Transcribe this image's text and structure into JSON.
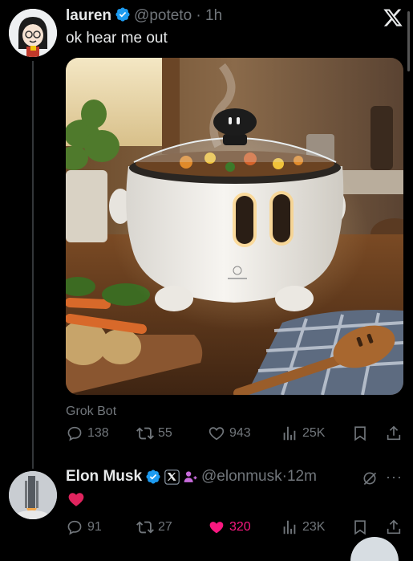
{
  "post1": {
    "display_name": "lauren",
    "handle": "@poteto",
    "time_sep": " · ",
    "time": "1h",
    "text": "ok hear me out",
    "media_source": "Grok Bot",
    "stats": {
      "replies": "138",
      "reposts": "55",
      "likes": "943",
      "views": "25K"
    }
  },
  "post2": {
    "display_name": "Elon Musk",
    "handle": "@elonmusk",
    "time_sep": "·",
    "time": "12m",
    "text_emoji": "heart-emoji",
    "more_label": "···",
    "stats": {
      "replies": "91",
      "reposts": "27",
      "likes": "320",
      "views": "23K"
    }
  },
  "colors": {
    "background": "#000000",
    "text": "#e7e9ea",
    "muted": "#71767b",
    "verified": "#1d9bf0",
    "like_active": "#f91880"
  },
  "icons": [
    "x-logo-icon",
    "verified-badge-icon",
    "reply-icon",
    "repost-icon",
    "like-icon",
    "views-icon",
    "bookmark-icon",
    "share-icon",
    "x-affiliate-icon",
    "affiliate-person-icon",
    "grok-icon"
  ]
}
